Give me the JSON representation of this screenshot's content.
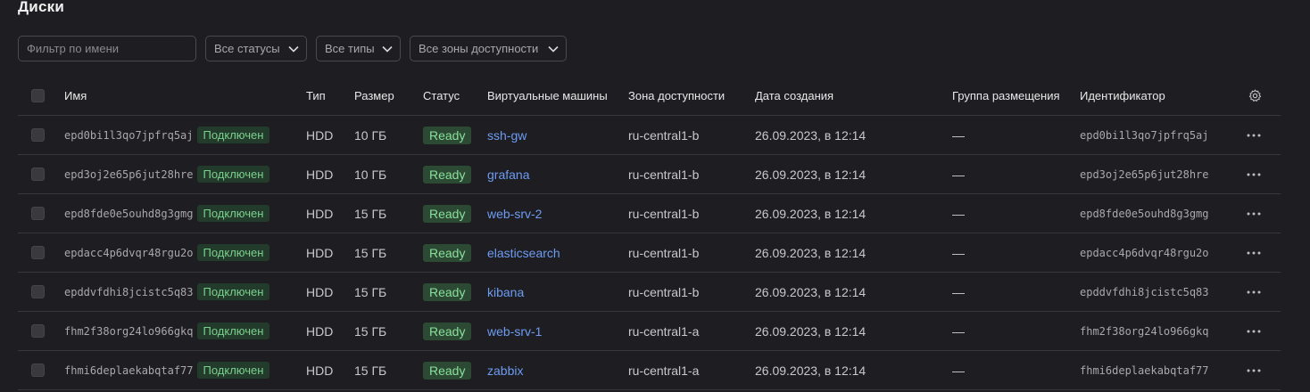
{
  "page": {
    "title": "Диски"
  },
  "filters": {
    "name_placeholder": "Фильтр по имени",
    "status_label": "Все статусы",
    "types_label": "Все типы",
    "zones_label": "Все зоны доступности"
  },
  "table": {
    "columns": {
      "name": "Имя",
      "type": "Тип",
      "size": "Размер",
      "status": "Статус",
      "vms": "Виртуальные машины",
      "zone": "Зона доступности",
      "created": "Дата создания",
      "placement_group": "Группа размещения",
      "id": "Идентификатор"
    },
    "rows": [
      {
        "name": "epd0bi1l3qo7jpfrq5aj",
        "badge": "Подключен",
        "type": "HDD",
        "size": "10 ГБ",
        "status": "Ready",
        "vm": "ssh-gw",
        "zone": "ru-central1-b",
        "created": "26.09.2023, в 12:14",
        "group": "—",
        "id": "epd0bi1l3qo7jpfrq5aj"
      },
      {
        "name": "epd3oj2e65p6jut28hre",
        "badge": "Подключен",
        "type": "HDD",
        "size": "10 ГБ",
        "status": "Ready",
        "vm": "grafana",
        "zone": "ru-central1-b",
        "created": "26.09.2023, в 12:14",
        "group": "—",
        "id": "epd3oj2e65p6jut28hre"
      },
      {
        "name": "epd8fde0e5ouhd8g3gmg",
        "badge": "Подключен",
        "type": "HDD",
        "size": "15 ГБ",
        "status": "Ready",
        "vm": "web-srv-2",
        "zone": "ru-central1-b",
        "created": "26.09.2023, в 12:14",
        "group": "—",
        "id": "epd8fde0e5ouhd8g3gmg"
      },
      {
        "name": "epdacc4p6dvqr48rgu2o",
        "badge": "Подключен",
        "type": "HDD",
        "size": "15 ГБ",
        "status": "Ready",
        "vm": "elasticsearch",
        "zone": "ru-central1-b",
        "created": "26.09.2023, в 12:14",
        "group": "—",
        "id": "epdacc4p6dvqr48rgu2o"
      },
      {
        "name": "epddvfdhi8jcistc5q83",
        "badge": "Подключен",
        "type": "HDD",
        "size": "15 ГБ",
        "status": "Ready",
        "vm": "kibana",
        "zone": "ru-central1-b",
        "created": "26.09.2023, в 12:14",
        "group": "—",
        "id": "epddvfdhi8jcistc5q83"
      },
      {
        "name": "fhm2f38org24lo966gkq",
        "badge": "Подключен",
        "type": "HDD",
        "size": "15 ГБ",
        "status": "Ready",
        "vm": "web-srv-1",
        "zone": "ru-central1-a",
        "created": "26.09.2023, в 12:14",
        "group": "—",
        "id": "fhm2f38org24lo966gkq"
      },
      {
        "name": "fhmi6deplaekabqtaf77",
        "badge": "Подключен",
        "type": "HDD",
        "size": "15 ГБ",
        "status": "Ready",
        "vm": "zabbix",
        "zone": "ru-central1-a",
        "created": "26.09.2023, в 12:14",
        "group": "—",
        "id": "fhmi6deplaekabqtaf77"
      }
    ]
  },
  "icons": {
    "settings": "gear-icon",
    "row_menu": "more-horizontal-icon",
    "dropdown": "chevron-down-icon"
  },
  "colors": {
    "background": "#1e1d21",
    "status_ready_bg": "#2c4a33",
    "status_ready_fg": "#89e09c",
    "link": "#6d9cf2"
  }
}
